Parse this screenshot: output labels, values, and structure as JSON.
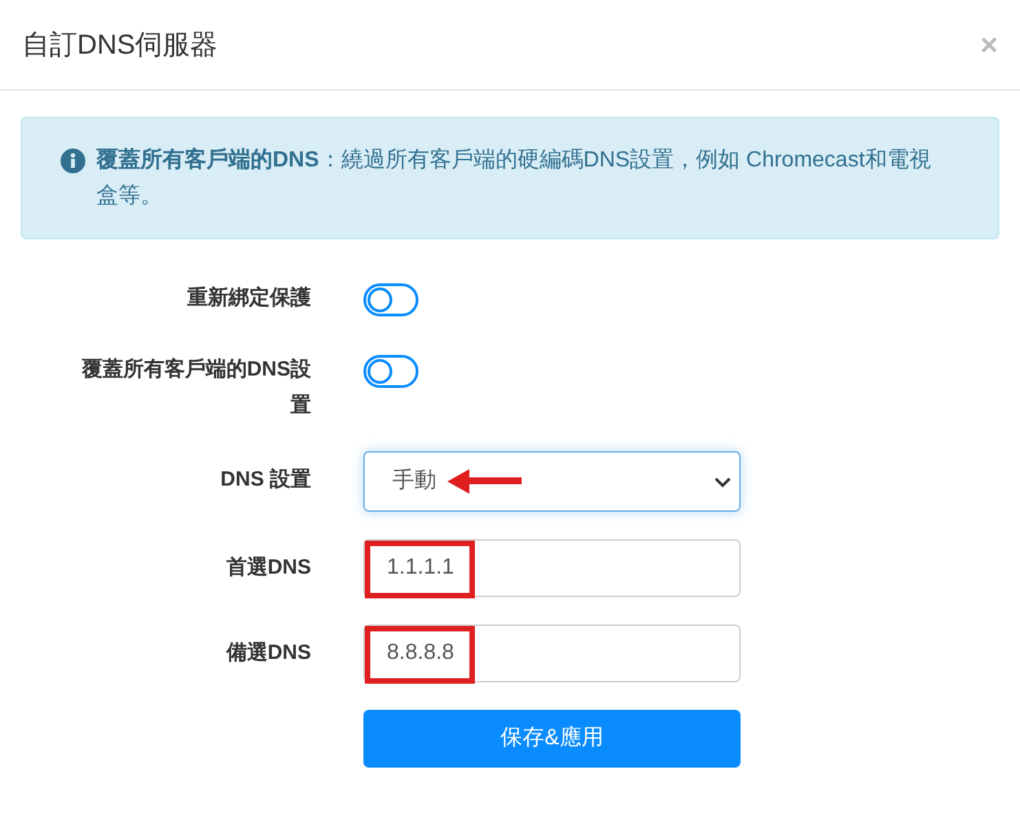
{
  "dialog": {
    "title": "自訂DNS伺服器",
    "close": "×"
  },
  "alert": {
    "text": "**覆蓋所有客戶端的DNS**：繞過所有客戶端的硬編碼DNS設置，例如 Chromecast和電視盒等。"
  },
  "fields": [
    {
      "kind": "toggle",
      "label": "重新綁定保護",
      "on": false
    },
    {
      "kind": "toggle",
      "label": "覆蓋所有客戶端的DNS設置",
      "on": false
    },
    {
      "kind": "select",
      "label": "DNS 設置",
      "value": "手動",
      "arrow_annotation": true
    },
    {
      "kind": "text",
      "label": "首選DNS",
      "value": "1.1.1.1",
      "highlighted": true
    },
    {
      "kind": "text",
      "label": "備選DNS",
      "value": "8.8.8.8",
      "highlighted": true
    }
  ],
  "submit": {
    "label": "保存&應用"
  }
}
